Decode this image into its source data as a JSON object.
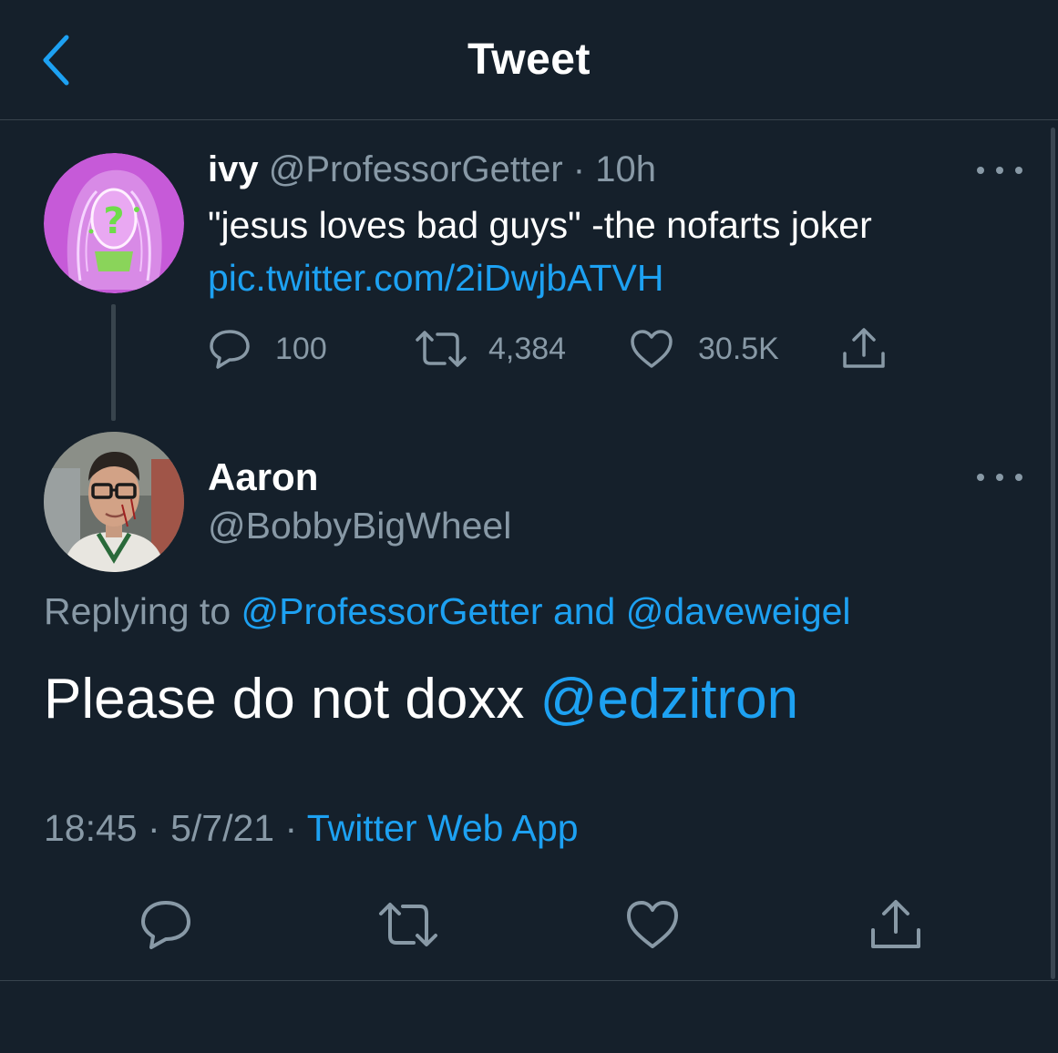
{
  "header": {
    "title": "Tweet"
  },
  "parent_tweet": {
    "display_name": "ivy",
    "handle": "@ProfessorGetter",
    "separator": "·",
    "time": "10h",
    "text": "\"jesus loves bad guys\" -the nofarts joker",
    "link": "pic.twitter.com/2iDwjbATVH",
    "stats": {
      "replies": "100",
      "retweets": "4,384",
      "likes": "30.5K"
    }
  },
  "reply_tweet": {
    "display_name": "Aaron",
    "handle": "@BobbyBigWheel",
    "replying_prefix": "Replying to",
    "replying_user1": "@ProfessorGetter",
    "replying_joiner": "and",
    "replying_user2": "@daveweigel",
    "text": "Please do not doxx",
    "mention": "@edzitron",
    "time": "18:45",
    "separator": "·",
    "date": "5/7/21",
    "source": "Twitter Web App"
  },
  "colors": {
    "background": "#15202b",
    "accent": "#1da1f2",
    "muted": "#8899a6",
    "divider": "#38444d"
  },
  "icons": [
    "back-chevron-icon",
    "more-icon",
    "reply-icon",
    "retweet-icon",
    "like-icon",
    "share-icon"
  ]
}
